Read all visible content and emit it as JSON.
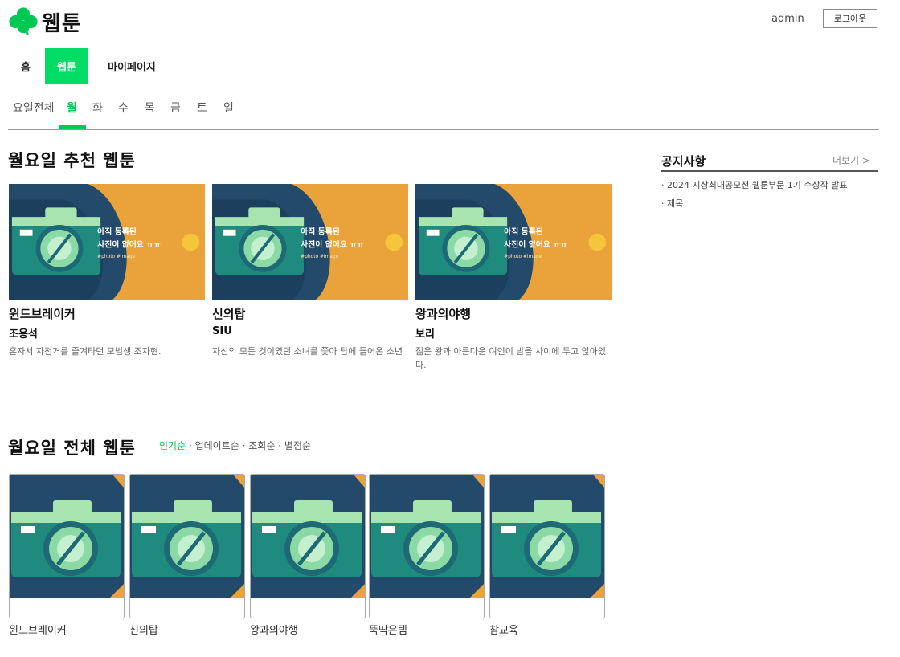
{
  "header": {
    "site_title": "웹툰",
    "user_name": "admin",
    "logout_label": "로그아웃",
    "logo_icon": "clover-icon",
    "brand_color": "#00dc64"
  },
  "nav": {
    "items": [
      {
        "label": "홈",
        "active": false
      },
      {
        "label": "웹툰",
        "active": true
      },
      {
        "label": "마이페이지",
        "active": false
      }
    ]
  },
  "day_tabs": {
    "items": [
      "요일전체",
      "월",
      "화",
      "수",
      "목",
      "금",
      "토",
      "일"
    ],
    "active": "월"
  },
  "recommend": {
    "title": "월요일 추천 웹툰",
    "thumb_text": {
      "line1": "아직 등록된",
      "line2": "사진이 없어요 ㅠㅠ",
      "tags": "#photo #image"
    },
    "cards": [
      {
        "title": "윈드브레이커",
        "author": "조용석",
        "desc": "혼자서 자전거를 즐겨타던 모범생 조자현."
      },
      {
        "title": "신의탑",
        "author": "SIU",
        "desc": "자신의 모든 것이였던 소녀를 쫓아 탑에 들어온 소년"
      },
      {
        "title": "왕과의야행",
        "author": "보리",
        "desc": "젊은 왕과 아름다운 여인이 밤을 사이에 두고 앉아있다."
      }
    ]
  },
  "notice": {
    "title": "공지사항",
    "more_label": "더보기 >",
    "items": [
      "· 2024 지상최대공모전 웹툰부문 1기 수상작 발표",
      "· 제목"
    ]
  },
  "all": {
    "title": "월요일 전체 웹툰",
    "sort_options": [
      "인기순",
      "업데이트순",
      "조회순",
      "별점순"
    ],
    "sort_active": "인기순",
    "separator": " · ",
    "cards": [
      "윈드브레이커",
      "신의탑",
      "왕과의야행",
      "뚝딱은템",
      "참교육"
    ]
  }
}
